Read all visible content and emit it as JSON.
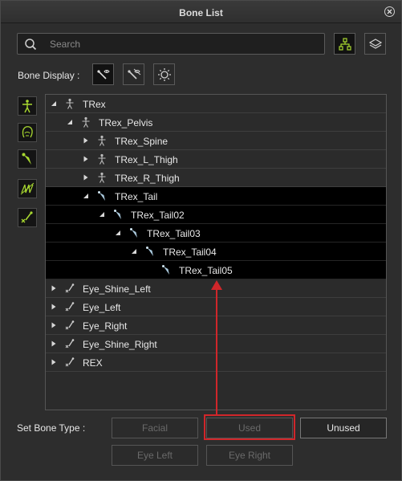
{
  "window": {
    "title": "Bone List"
  },
  "search": {
    "placeholder": "Search",
    "value": ""
  },
  "toolbar": {
    "hierarchy_icon": "hierarchy-icon",
    "layers_icon": "layers-icon"
  },
  "bone_display": {
    "label": "Bone Display :",
    "buttons": [
      "bone-view-icon",
      "bone-hide-icon",
      "sun-icon"
    ]
  },
  "side_filters": [
    "humanoid-icon",
    "head-icon",
    "bone-icon",
    "spring-icon",
    "unused-bone-icon"
  ],
  "tree": [
    {
      "label": "TRex",
      "depth": 0,
      "expanded": true,
      "icon": "humanoid-icon",
      "selected": false
    },
    {
      "label": "TRex_Pelvis",
      "depth": 1,
      "expanded": true,
      "icon": "humanoid-icon",
      "selected": false
    },
    {
      "label": "TRex_Spine",
      "depth": 2,
      "expanded": false,
      "icon": "humanoid-icon",
      "selected": false
    },
    {
      "label": "TRex_L_Thigh",
      "depth": 2,
      "expanded": false,
      "icon": "humanoid-icon",
      "selected": false
    },
    {
      "label": "TRex_R_Thigh",
      "depth": 2,
      "expanded": false,
      "icon": "humanoid-icon",
      "selected": false
    },
    {
      "label": "TRex_Tail",
      "depth": 2,
      "expanded": true,
      "icon": "bone-icon",
      "selected": true
    },
    {
      "label": "TRex_Tail02",
      "depth": 3,
      "expanded": true,
      "icon": "bone-icon",
      "selected": true
    },
    {
      "label": "TRex_Tail03",
      "depth": 4,
      "expanded": true,
      "icon": "bone-icon",
      "selected": true
    },
    {
      "label": "TRex_Tail04",
      "depth": 5,
      "expanded": true,
      "icon": "bone-icon",
      "selected": true
    },
    {
      "label": "TRex_Tail05",
      "depth": 6,
      "expanded": null,
      "icon": "bone-icon",
      "selected": true
    },
    {
      "label": "Eye_Shine_Left",
      "depth": 0,
      "expanded": false,
      "icon": "unused-bone-icon",
      "selected": false
    },
    {
      "label": "Eye_Left",
      "depth": 0,
      "expanded": false,
      "icon": "unused-bone-icon",
      "selected": false
    },
    {
      "label": "Eye_Right",
      "depth": 0,
      "expanded": false,
      "icon": "unused-bone-icon",
      "selected": false
    },
    {
      "label": "Eye_Shine_Right",
      "depth": 0,
      "expanded": false,
      "icon": "unused-bone-icon",
      "selected": false
    },
    {
      "label": "REX",
      "depth": 0,
      "expanded": false,
      "icon": "unused-bone-icon",
      "selected": false
    }
  ],
  "set_bone_type": {
    "label": "Set Bone Type :",
    "facial": "Facial",
    "used": "Used",
    "unused": "Unused",
    "eye_left": "Eye Left",
    "eye_right": "Eye Right"
  },
  "colors": {
    "accent_green": "#b6e03a",
    "highlight_red": "#d0262a",
    "selected_row": "#000000"
  }
}
